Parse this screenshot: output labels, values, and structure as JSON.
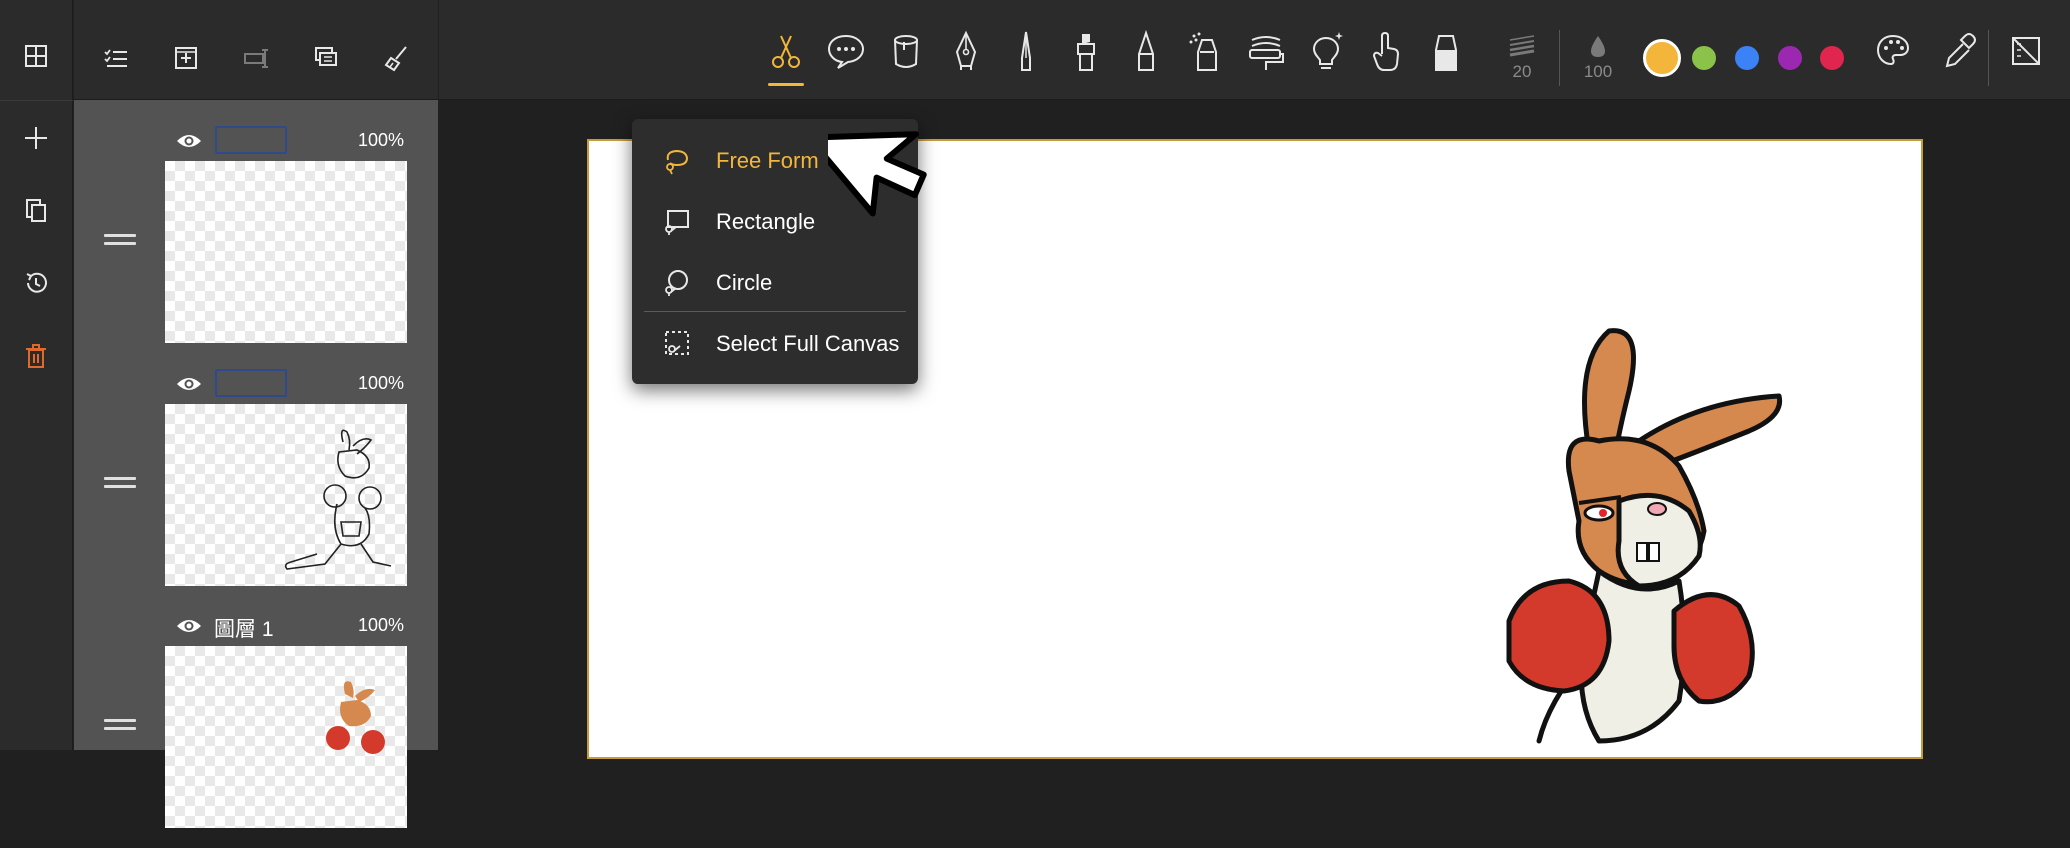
{
  "rail": {
    "buttons": [
      "grid-icon",
      "add-icon",
      "copy-icon",
      "history-icon",
      "trash-icon"
    ]
  },
  "layers_toolbar": {
    "buttons": [
      "multi-select-icon",
      "add-layer-icon",
      "rename-layer-icon",
      "merge-layer-icon",
      "clear-layer-icon"
    ]
  },
  "layers": [
    {
      "name": "",
      "opacity": "100%",
      "visible": true
    },
    {
      "name": "",
      "opacity": "100%",
      "visible": true
    },
    {
      "name": "圖層 1",
      "opacity": "100%",
      "visible": true
    }
  ],
  "toolbar": {
    "tools": [
      "scissors-icon",
      "speech-bubble-icon",
      "bucket-icon",
      "fountain-pen-icon",
      "pen-nib-icon",
      "marker-icon",
      "pencil-icon",
      "airbrush-icon",
      "roller-icon",
      "light-bulb-icon",
      "hand-icon",
      "eraser-icon"
    ],
    "active_tool": "scissors-icon",
    "brush_size": "20",
    "brush_opacity": "100",
    "colors": [
      "#f3b63a",
      "#8bc34a",
      "#3b82f6",
      "#9c27b0",
      "#e0264f"
    ],
    "selected_color": "#f3b63a"
  },
  "selection_menu": {
    "items": [
      {
        "label": "Free Form",
        "icon": "lasso-icon",
        "active": true
      },
      {
        "label": "Rectangle",
        "icon": "rect-select-icon",
        "active": false
      },
      {
        "label": "Circle",
        "icon": "circle-select-icon",
        "active": false
      },
      {
        "label": "Select Full Canvas",
        "icon": "full-canvas-icon",
        "active": false
      }
    ]
  },
  "canvas": {
    "image": "boxing-rabbit"
  }
}
